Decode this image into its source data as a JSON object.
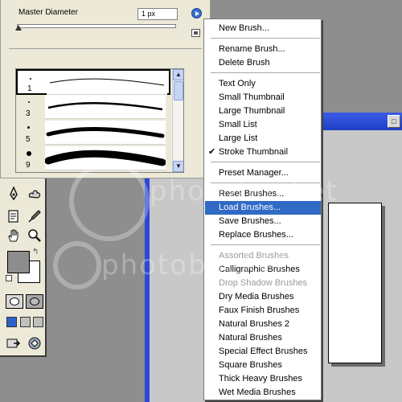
{
  "brush_panel": {
    "master_diameter_label": "Master Diameter",
    "diameter_value": "1 px",
    "slider_value_fraction": 0.0,
    "brushes": [
      {
        "size": "1",
        "selected": true
      },
      {
        "size": "3",
        "selected": false
      },
      {
        "size": "5",
        "selected": false
      },
      {
        "size": "9",
        "selected": false
      }
    ]
  },
  "menu": {
    "items": [
      {
        "label": "New Brush...",
        "enabled": true
      },
      {
        "label": "Rename Brush...",
        "enabled": true
      },
      {
        "label": "Delete Brush",
        "enabled": true
      },
      {
        "label": "Text Only",
        "enabled": true
      },
      {
        "label": "Small Thumbnail",
        "enabled": true
      },
      {
        "label": "Large Thumbnail",
        "enabled": true
      },
      {
        "label": "Small List",
        "enabled": true
      },
      {
        "label": "Large List",
        "enabled": true
      },
      {
        "label": "Stroke Thumbnail",
        "enabled": true,
        "checked": true
      },
      {
        "label": "Preset Manager...",
        "enabled": true
      },
      {
        "label": "Reset Brushes...",
        "enabled": true
      },
      {
        "label": "Load Brushes...",
        "enabled": true,
        "highlighted": true
      },
      {
        "label": "Save Brushes...",
        "enabled": true
      },
      {
        "label": "Replace Brushes...",
        "enabled": true
      },
      {
        "label": "Assorted Brushes",
        "enabled": false
      },
      {
        "label": "Calligraphic Brushes",
        "enabled": true
      },
      {
        "label": "Drop Shadow Brushes",
        "enabled": false
      },
      {
        "label": "Dry Media Brushes",
        "enabled": true
      },
      {
        "label": "Faux Finish Brushes",
        "enabled": true
      },
      {
        "label": "Natural Brushes 2",
        "enabled": true
      },
      {
        "label": "Natural Brushes",
        "enabled": true
      },
      {
        "label": "Special Effect Brushes",
        "enabled": true
      },
      {
        "label": "Square Brushes",
        "enabled": true
      },
      {
        "label": "Thick Heavy Brushes",
        "enabled": true
      },
      {
        "label": "Wet Media Brushes",
        "enabled": true
      }
    ],
    "highlight_color": "#316ac5",
    "disabled_color": "#9a9a9a"
  },
  "toolbox": {
    "tools": [
      "pen-icon",
      "custom-shape-icon",
      "notes-icon",
      "eyedropper-icon",
      "hand-icon",
      "zoom-icon"
    ],
    "foreground_color": "#8d8d8d",
    "background_color": "#ffffff"
  },
  "document": {
    "titlebar_button": "□",
    "frame_color": "#2b49d6"
  },
  "watermark": {
    "text": "photobucket"
  }
}
